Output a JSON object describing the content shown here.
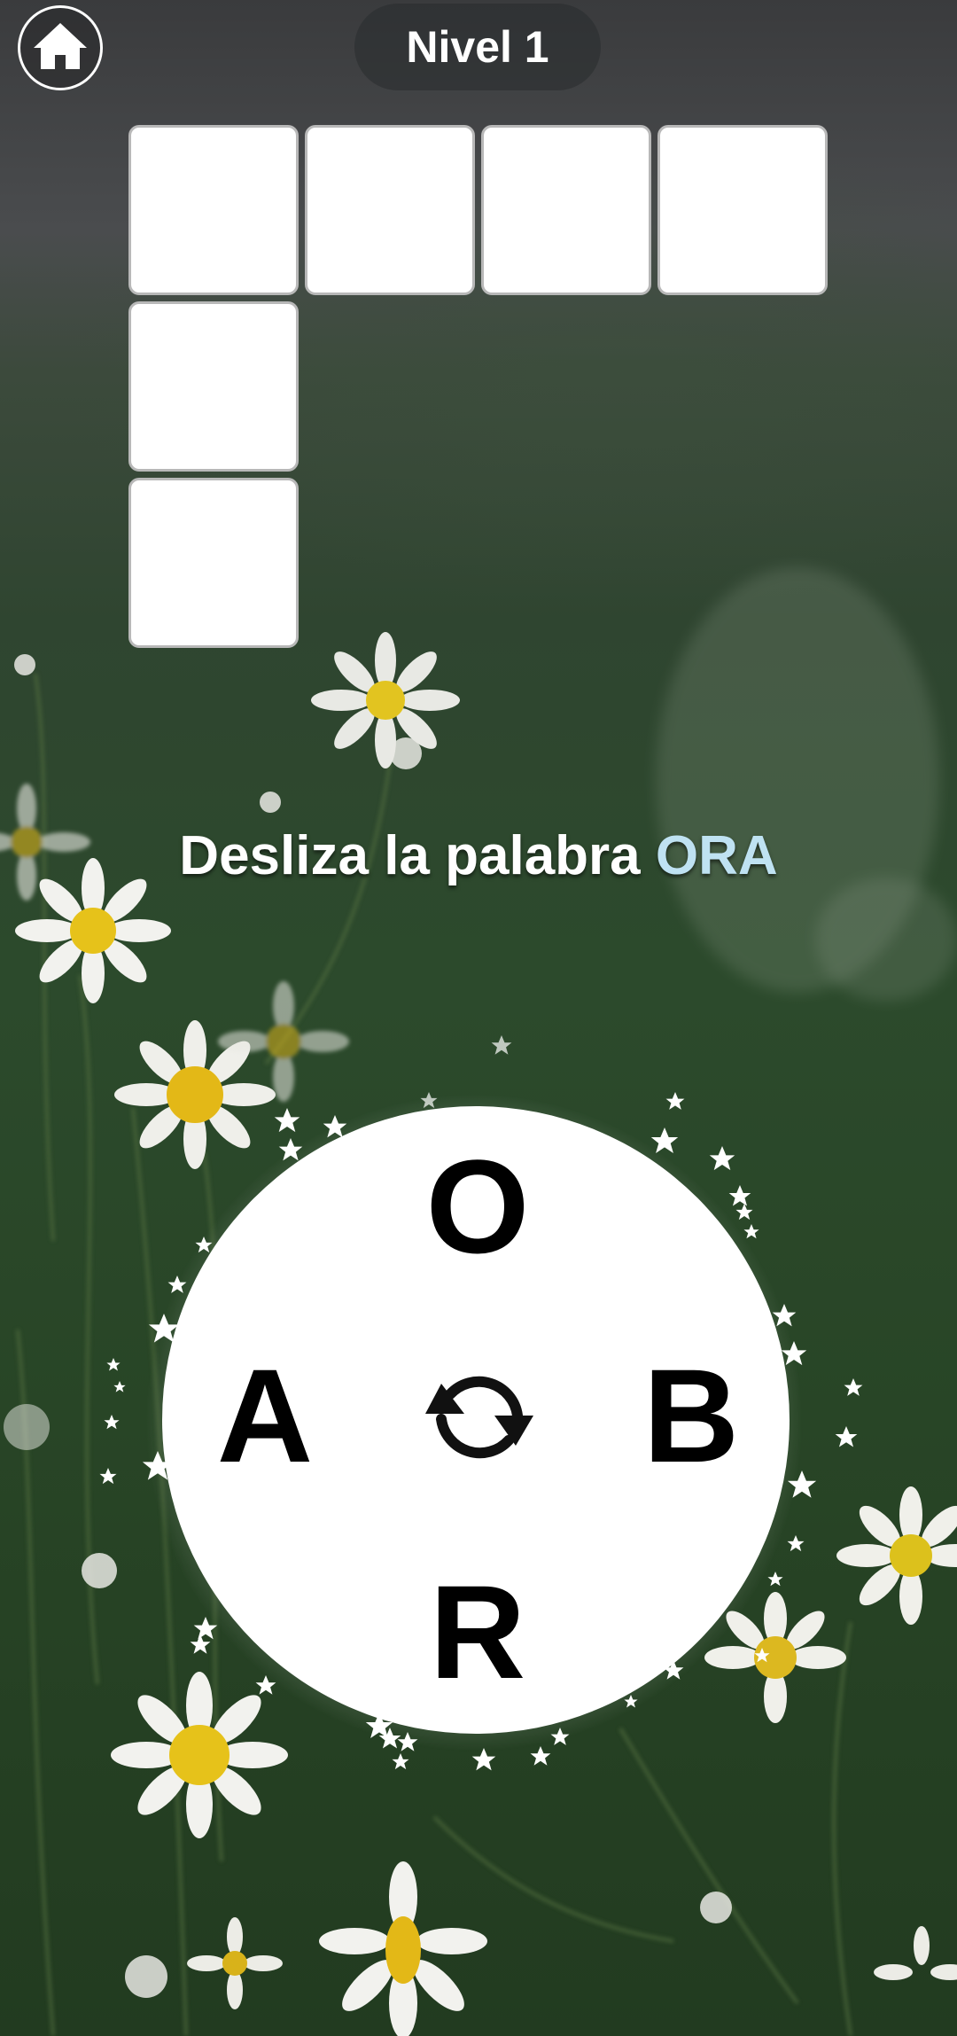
{
  "header": {
    "home_icon": "home-icon",
    "level_label": "Nivel 1"
  },
  "board": {
    "tiles_filled": 0,
    "tiles_total": 6
  },
  "hint": {
    "prefix": "Desliza la palabra",
    "word": "ORA"
  },
  "wheel": {
    "letters": {
      "top": "O",
      "left": "A",
      "right": "B",
      "bottom": "R"
    },
    "shuffle_icon": "shuffle-icon"
  },
  "colors": {
    "hint_text": "#ffffff",
    "hint_word": "#bfe2f2",
    "tile_fill": "#ffffff",
    "letter": "#000000"
  }
}
